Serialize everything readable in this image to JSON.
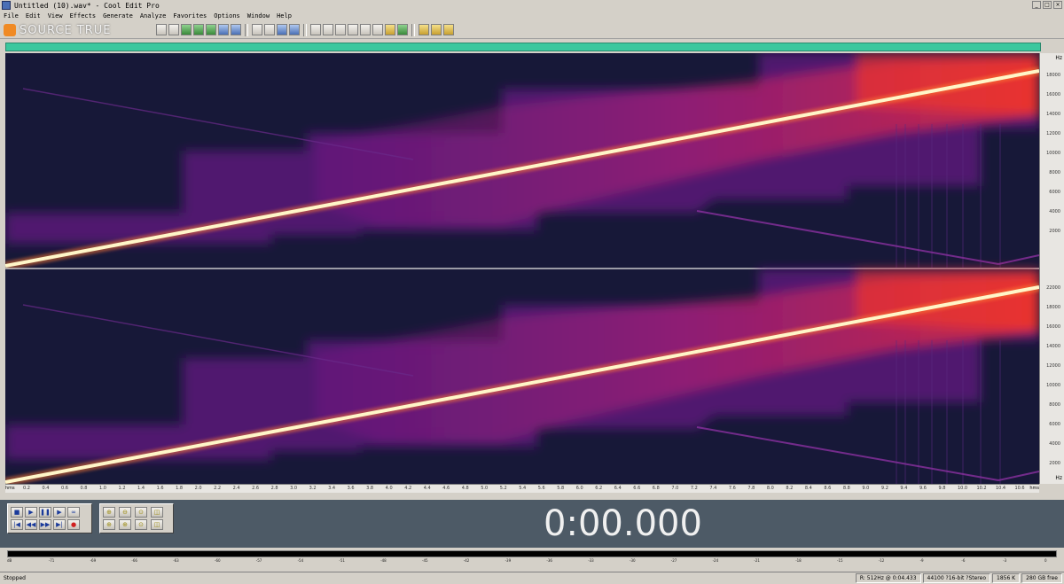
{
  "window": {
    "title": "Untitled (10).wav* - Cool Edit Pro",
    "minimize_glyph": "_",
    "maximize_glyph": "□",
    "close_glyph": "×"
  },
  "menu": [
    "File",
    "Edit",
    "View",
    "Effects",
    "Generate",
    "Analyze",
    "Favorites",
    "Options",
    "Window",
    "Help"
  ],
  "watermark": {
    "text": "SOURCE TRUE"
  },
  "spectrogram": {
    "hz_unit": "Hz",
    "top_channel_ticks": [
      "18000",
      "16000",
      "14000",
      "12000",
      "10000",
      "8000",
      "6000",
      "4000",
      "2000"
    ],
    "bottom_channel_ticks": [
      "22000",
      "18000",
      "16000",
      "14000",
      "12000",
      "10000",
      "8000",
      "6000",
      "4000",
      "2000"
    ]
  },
  "time_ruler": {
    "unit": "hms",
    "ticks": [
      "0.2",
      "0.4",
      "0.6",
      "0.8",
      "1.0",
      "1.2",
      "1.4",
      "1.6",
      "1.8",
      "2.0",
      "2.2",
      "2.4",
      "2.6",
      "2.8",
      "3.0",
      "3.2",
      "3.4",
      "3.6",
      "3.8",
      "4.0",
      "4.2",
      "4.4",
      "4.6",
      "4.8",
      "5.0",
      "5.2",
      "5.4",
      "5.6",
      "5.8",
      "6.0",
      "6.2",
      "6.4",
      "6.6",
      "6.8",
      "7.0",
      "7.2",
      "7.4",
      "7.6",
      "7.8",
      "8.0",
      "8.2",
      "8.4",
      "8.6",
      "8.8",
      "9.0",
      "9.2",
      "9.4",
      "9.6",
      "9.8",
      "10.0",
      "10.2",
      "10.4",
      "10.6"
    ],
    "end_unit": "hms"
  },
  "transport": {
    "stop_glyph": "■",
    "play_glyph": "▶",
    "pause_glyph": "❚❚",
    "play_from_glyph": "▶",
    "loop_glyph": "∞",
    "go_start_glyph": "|◀",
    "rewind_glyph": "◀◀",
    "ffwd_glyph": "▶▶",
    "go_end_glyph": "▶|",
    "record_glyph": "●"
  },
  "zoom": {
    "zoom_in_glyph": "⊕",
    "zoom_out_glyph": "⊖",
    "zoom_full_glyph": "⊙",
    "zoom_sel_glyph": "◫"
  },
  "time_display": "0:00.000",
  "meter": {
    "ticks": [
      "dB",
      "-71",
      "-69",
      "-66",
      "-63",
      "-60",
      "-57",
      "-54",
      "-51",
      "-48",
      "-45",
      "-42",
      "-39",
      "-36",
      "-33",
      "-30",
      "-27",
      "-24",
      "-21",
      "-18",
      "-15",
      "-12",
      "-9",
      "-6",
      "-3",
      "0"
    ]
  },
  "status": {
    "state": "Stopped",
    "resolution": "R: 512Hz @ 0:04.433",
    "format": "44100 ?16-bit ?Stereo",
    "file_size": "1856 K",
    "free_space": "280 GB free"
  }
}
